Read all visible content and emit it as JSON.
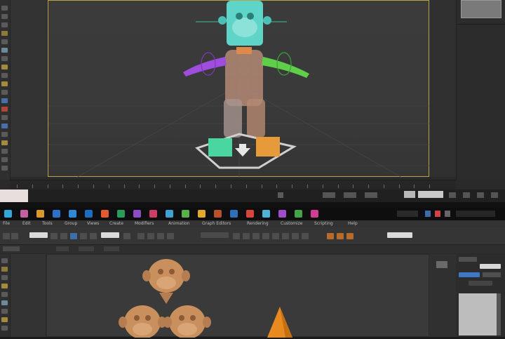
{
  "top_window": {
    "viewport_label": "",
    "timeline_ticks": 28
  },
  "taskbar": {
    "icons": [
      {
        "name": "app-icon-1",
        "color": "#31a8d8"
      },
      {
        "name": "app-icon-2",
        "color": "#c45fa0"
      },
      {
        "name": "app-icon-3",
        "color": "#d99a2b"
      },
      {
        "name": "app-icon-4",
        "color": "#2c70c8"
      },
      {
        "name": "app-icon-5",
        "color": "#2f88d6"
      },
      {
        "name": "app-icon-6",
        "color": "#1d6dbf"
      },
      {
        "name": "app-icon-7",
        "color": "#e05a32"
      },
      {
        "name": "app-icon-8",
        "color": "#2a9c59"
      },
      {
        "name": "app-icon-9",
        "color": "#8b4cc4"
      },
      {
        "name": "app-icon-10",
        "color": "#cb3e68"
      },
      {
        "name": "app-icon-11",
        "color": "#3ea1d1"
      },
      {
        "name": "app-icon-12",
        "color": "#58b04b"
      },
      {
        "name": "app-icon-13",
        "color": "#e3a92c"
      },
      {
        "name": "app-icon-14",
        "color": "#b8502e"
      },
      {
        "name": "app-icon-15",
        "color": "#2f6fb6"
      },
      {
        "name": "app-icon-16",
        "color": "#d4463b"
      },
      {
        "name": "app-icon-17",
        "color": "#4fb0d8"
      },
      {
        "name": "app-icon-18",
        "color": "#9d4ec8"
      },
      {
        "name": "app-icon-19",
        "color": "#43a347"
      },
      {
        "name": "app-icon-20",
        "color": "#cf3f91"
      }
    ]
  },
  "bottom_window": {
    "menu": [
      "File",
      "Edit",
      "Tools",
      "Group",
      "Views",
      "Create",
      "Modifiers",
      "Animation",
      "Graph Editors",
      "Rendering",
      "Customize",
      "Scripting",
      "Help"
    ]
  },
  "colors": {
    "viewport_border_active": "#b8a24a",
    "rig_head": "#5fd4c8",
    "rig_arm_left": "#9e4ddc",
    "rig_arm_right": "#5fcf4a",
    "rig_body": "#b58a74",
    "foot_left": "#4ad6a0",
    "foot_right": "#e69a3a",
    "clay": "#c9905e"
  }
}
